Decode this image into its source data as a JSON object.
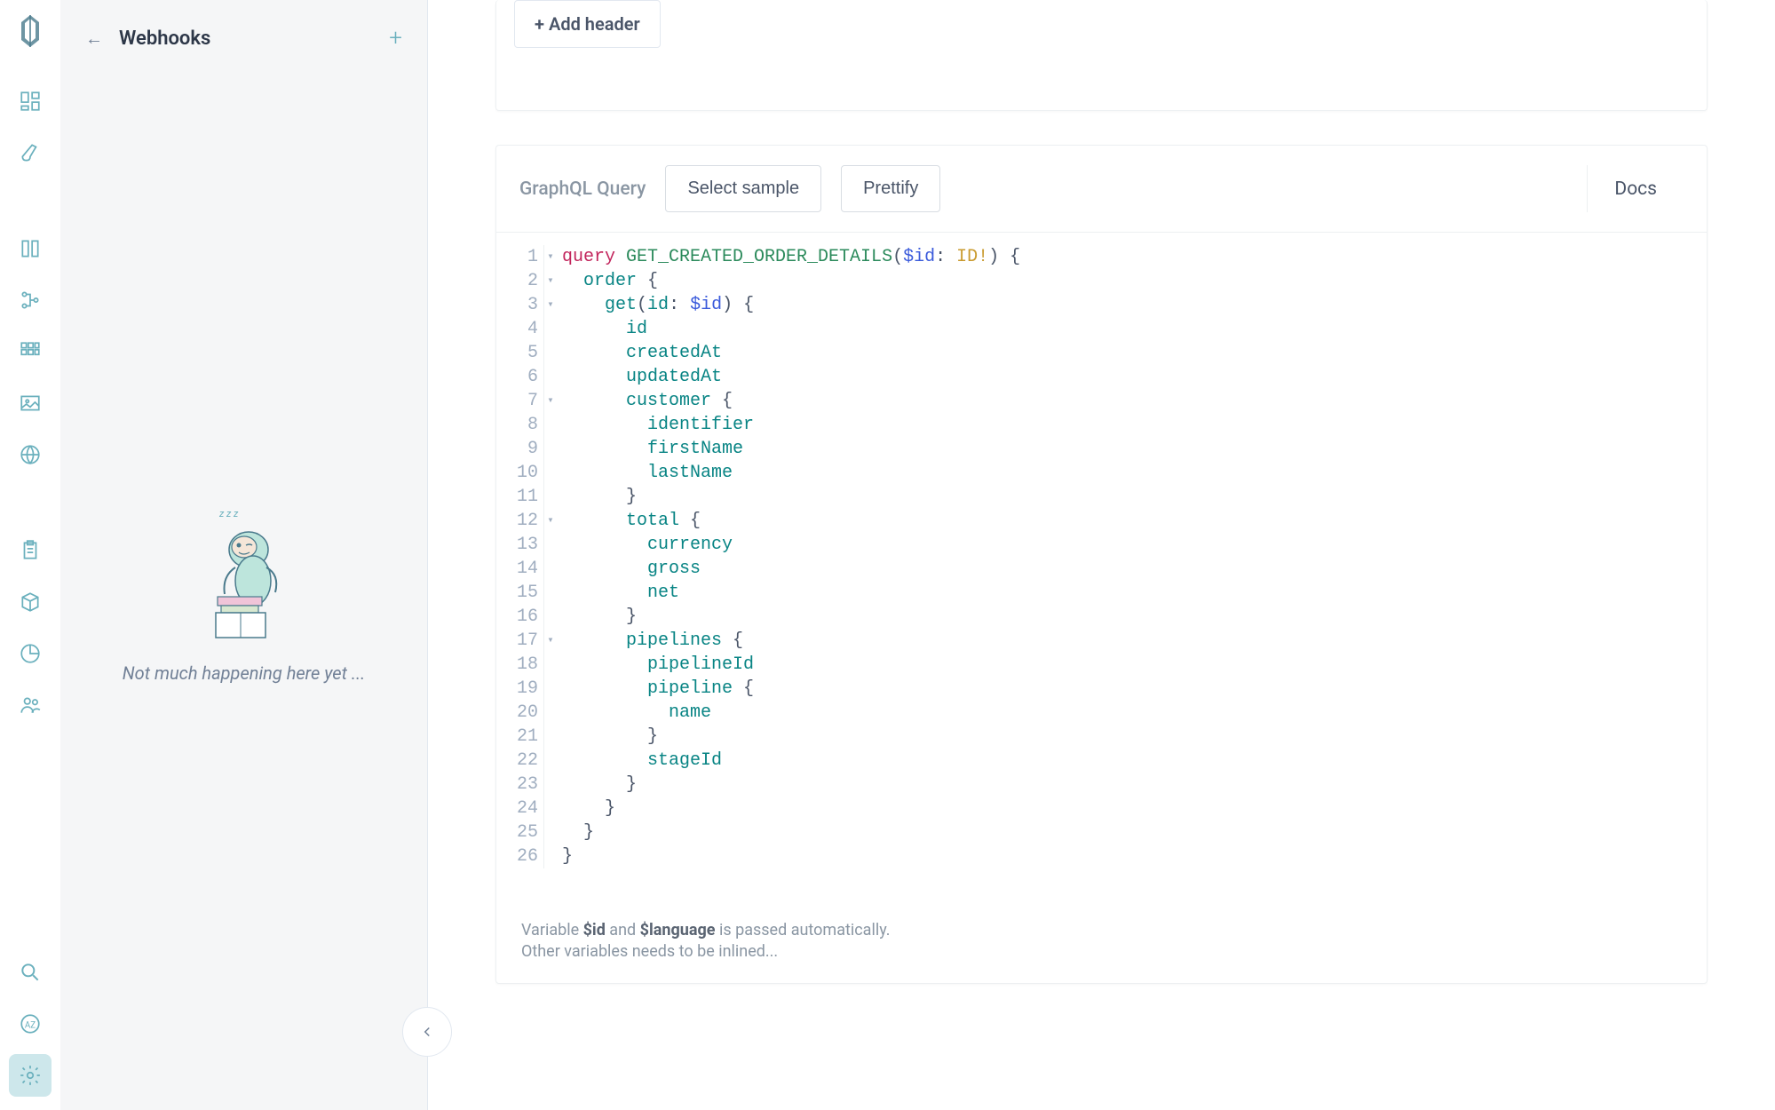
{
  "sidebar": {
    "title": "Webhooks",
    "empty_text": "Not much happening here yet ..."
  },
  "headers_card": {
    "add_header_label": "+ Add header"
  },
  "query": {
    "label": "GraphQL Query",
    "select_sample_label": "Select sample",
    "prettify_label": "Prettify",
    "docs_label": "Docs",
    "code": {
      "lines": [
        {
          "n": 1,
          "fold": true,
          "tokens": [
            [
              "keyword",
              "query "
            ],
            [
              "def",
              "GET_CREATED_ORDER_DETAILS"
            ],
            [
              "punc",
              "("
            ],
            [
              "variable",
              "$id"
            ],
            [
              "punc",
              ": "
            ],
            [
              "type",
              "ID!"
            ],
            [
              "punc",
              ") {"
            ]
          ]
        },
        {
          "n": 2,
          "fold": true,
          "tokens": [
            [
              "punc",
              "  "
            ],
            [
              "attr",
              "order"
            ],
            [
              "punc",
              " {"
            ]
          ]
        },
        {
          "n": 3,
          "fold": true,
          "tokens": [
            [
              "punc",
              "    "
            ],
            [
              "attr",
              "get"
            ],
            [
              "punc",
              "("
            ],
            [
              "attr",
              "id"
            ],
            [
              "punc",
              ": "
            ],
            [
              "variable",
              "$id"
            ],
            [
              "punc",
              ") {"
            ]
          ]
        },
        {
          "n": 4,
          "fold": false,
          "tokens": [
            [
              "punc",
              "      "
            ],
            [
              "attr",
              "id"
            ]
          ]
        },
        {
          "n": 5,
          "fold": false,
          "tokens": [
            [
              "punc",
              "      "
            ],
            [
              "attr",
              "createdAt"
            ]
          ]
        },
        {
          "n": 6,
          "fold": false,
          "tokens": [
            [
              "punc",
              "      "
            ],
            [
              "attr",
              "updatedAt"
            ]
          ]
        },
        {
          "n": 7,
          "fold": true,
          "tokens": [
            [
              "punc",
              "      "
            ],
            [
              "attr",
              "customer"
            ],
            [
              "punc",
              " {"
            ]
          ]
        },
        {
          "n": 8,
          "fold": false,
          "tokens": [
            [
              "punc",
              "        "
            ],
            [
              "attr",
              "identifier"
            ]
          ]
        },
        {
          "n": 9,
          "fold": false,
          "tokens": [
            [
              "punc",
              "        "
            ],
            [
              "attr",
              "firstName"
            ]
          ]
        },
        {
          "n": 10,
          "fold": false,
          "tokens": [
            [
              "punc",
              "        "
            ],
            [
              "attr",
              "lastName"
            ]
          ]
        },
        {
          "n": 11,
          "fold": false,
          "tokens": [
            [
              "punc",
              "      }"
            ]
          ]
        },
        {
          "n": 12,
          "fold": true,
          "tokens": [
            [
              "punc",
              "      "
            ],
            [
              "attr",
              "total"
            ],
            [
              "punc",
              " {"
            ]
          ]
        },
        {
          "n": 13,
          "fold": false,
          "tokens": [
            [
              "punc",
              "        "
            ],
            [
              "attr",
              "currency"
            ]
          ]
        },
        {
          "n": 14,
          "fold": false,
          "tokens": [
            [
              "punc",
              "        "
            ],
            [
              "attr",
              "gross"
            ]
          ]
        },
        {
          "n": 15,
          "fold": false,
          "tokens": [
            [
              "punc",
              "        "
            ],
            [
              "attr",
              "net"
            ]
          ]
        },
        {
          "n": 16,
          "fold": false,
          "tokens": [
            [
              "punc",
              "      }"
            ]
          ]
        },
        {
          "n": 17,
          "fold": true,
          "tokens": [
            [
              "punc",
              "      "
            ],
            [
              "attr",
              "pipelines"
            ],
            [
              "punc",
              " {"
            ]
          ]
        },
        {
          "n": 18,
          "fold": false,
          "tokens": [
            [
              "punc",
              "        "
            ],
            [
              "attr",
              "pipelineId"
            ]
          ]
        },
        {
          "n": 19,
          "fold": false,
          "tokens": [
            [
              "punc",
              "        "
            ],
            [
              "attr",
              "pipeline"
            ],
            [
              "punc",
              " {"
            ]
          ]
        },
        {
          "n": 20,
          "fold": false,
          "tokens": [
            [
              "punc",
              "          "
            ],
            [
              "attr",
              "name"
            ]
          ]
        },
        {
          "n": 21,
          "fold": false,
          "tokens": [
            [
              "punc",
              "        }"
            ]
          ]
        },
        {
          "n": 22,
          "fold": false,
          "tokens": [
            [
              "punc",
              "        "
            ],
            [
              "attr",
              "stageId"
            ]
          ]
        },
        {
          "n": 23,
          "fold": false,
          "tokens": [
            [
              "punc",
              "      }"
            ]
          ]
        },
        {
          "n": 24,
          "fold": false,
          "tokens": [
            [
              "punc",
              "    }"
            ]
          ]
        },
        {
          "n": 25,
          "fold": false,
          "tokens": [
            [
              "punc",
              "  }"
            ]
          ]
        },
        {
          "n": 26,
          "fold": false,
          "tokens": [
            [
              "punc",
              "}"
            ]
          ]
        }
      ]
    },
    "footer": {
      "prefix": "Variable ",
      "var1": "$id",
      "mid": " and ",
      "var2": "$language",
      "suffix": " is passed automatically.",
      "line2": "Other variables needs to be inlined..."
    }
  },
  "rail_icons": [
    "dashboard-icon",
    "design-icon",
    "catalog-icon",
    "schema-icon",
    "grid-icon",
    "image-icon",
    "globe-icon",
    "clipboard-icon",
    "box-icon",
    "chart-icon",
    "users-icon"
  ],
  "rail_bottom_icons": [
    "search-icon",
    "translate-icon",
    "settings-icon"
  ]
}
